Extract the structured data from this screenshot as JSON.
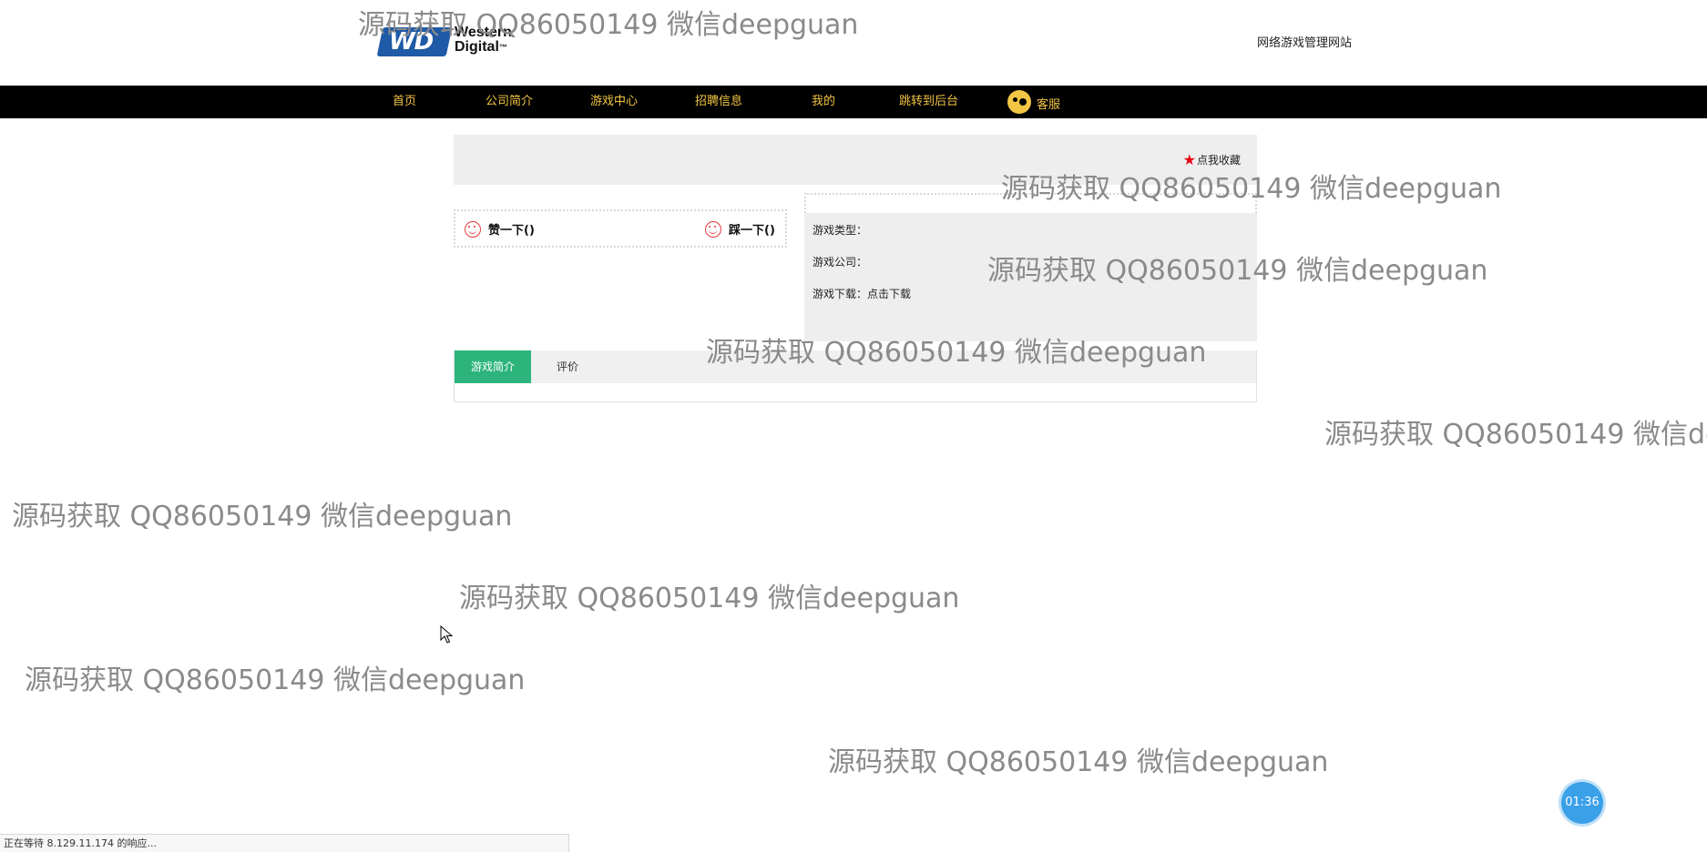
{
  "header": {
    "logo": {
      "badge_text": "WD",
      "name_line1": "Western",
      "name_line2": "Digital",
      "mark": "™"
    },
    "site_title": "网络游戏管理网站"
  },
  "nav": {
    "items": [
      "首页",
      "公司简介",
      "游戏中心",
      "招聘信息",
      "我的",
      "跳转到后台"
    ],
    "kefu_label": "客服",
    "text_color": "#f3c544",
    "background": "#000000"
  },
  "favorite": {
    "label": "点我收藏",
    "star_icon": "red-star-icon"
  },
  "votes": {
    "like_label": "赞一下()",
    "dislike_label": "踩一下()"
  },
  "game_info": {
    "type_label": "游戏类型：",
    "company_label": "游戏公司：",
    "download_label": "游戏下载：",
    "download_link": "点击下载"
  },
  "tabs": {
    "items": [
      "游戏简介",
      "评价"
    ],
    "active_color": "#2db47d"
  },
  "watermark": {
    "text": "源码获取 QQ86050149 微信deepguan"
  },
  "timer": {
    "value": "01:36"
  },
  "status_bar": {
    "text": "正在等待 8.129.11.174 的响应..."
  }
}
